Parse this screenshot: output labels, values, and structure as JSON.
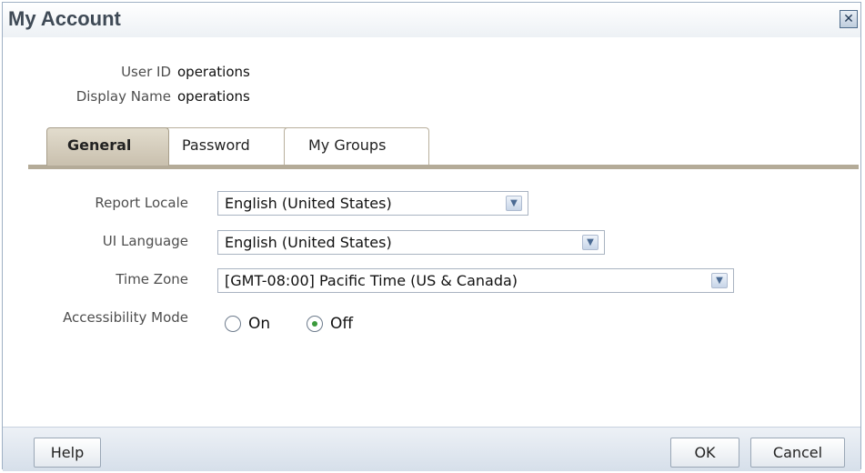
{
  "dialog": {
    "title": "My Account",
    "close_icon": "close-icon"
  },
  "account": {
    "user_id_label": "User ID",
    "user_id_value": "operations",
    "display_name_label": "Display Name",
    "display_name_value": "operations"
  },
  "tabs": [
    {
      "label": "General",
      "selected": true
    },
    {
      "label": "Password",
      "selected": false
    },
    {
      "label": "My Groups",
      "selected": false
    }
  ],
  "form": {
    "report_locale_label": "Report Locale",
    "report_locale_value": "English (United States)",
    "ui_language_label": "UI Language",
    "ui_language_value": "English (United States)",
    "time_zone_label": "Time Zone",
    "time_zone_value": "[GMT-08:00] Pacific Time (US & Canada)",
    "accessibility_label": "Accessibility Mode",
    "accessibility_on_label": "On",
    "accessibility_off_label": "Off",
    "accessibility_selected": "Off"
  },
  "footer": {
    "help_label": "Help",
    "ok_label": "OK",
    "cancel_label": "Cancel"
  },
  "icons": {
    "dropdown": "chevron-down-icon",
    "close": "close-icon",
    "radio": "radio-icon"
  },
  "colors": {
    "title_text": "#3f4a56",
    "tab_active_bg": "#cfc7b6",
    "tab_strip": "#b4ab98",
    "footer_bg": "#dfe6ef",
    "radio_selected": "#3b9a3b"
  }
}
